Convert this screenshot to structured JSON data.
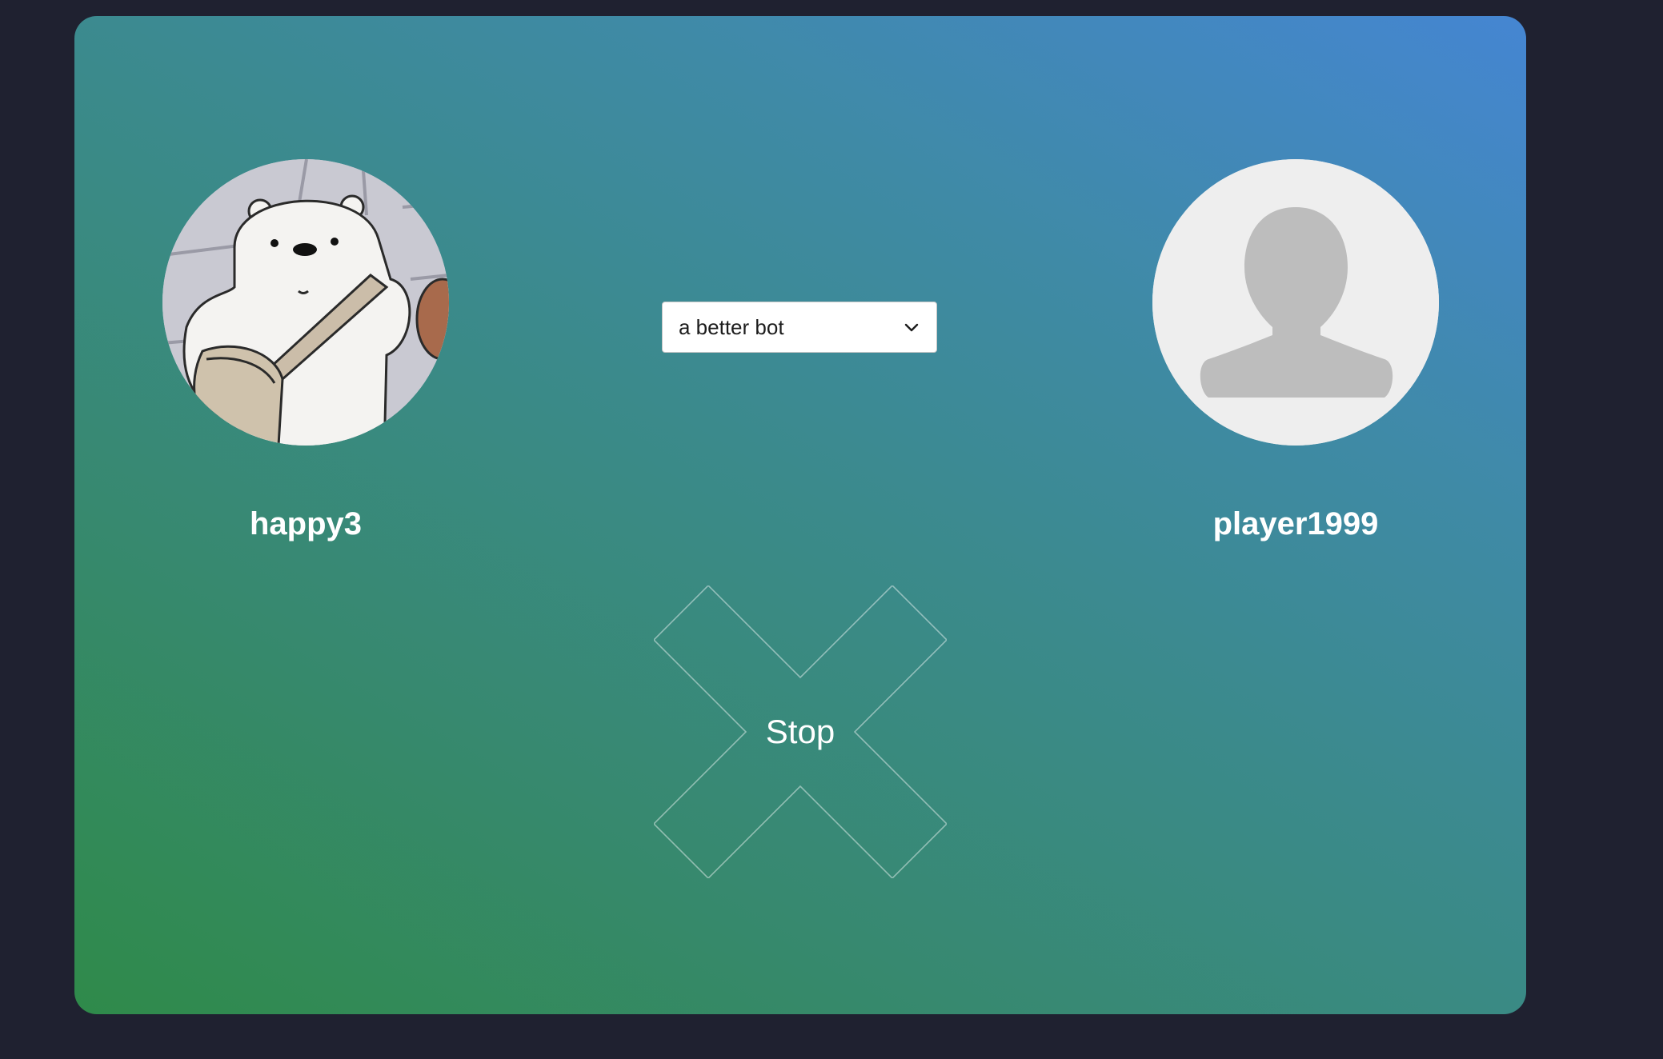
{
  "players": {
    "left": {
      "name": "happy3",
      "avatar": "polar-bear-avatar"
    },
    "right": {
      "name": "player1999",
      "avatar": "default-user-avatar"
    }
  },
  "opponent_select": {
    "selected": "a better bot",
    "icon": "chevron-down-icon"
  },
  "stop_button": {
    "label": "Stop",
    "icon": "x-cross-icon"
  },
  "colors": {
    "page_background": "#1f2130",
    "gradient_start": "#2f8a4a",
    "gradient_end": "#4586d2",
    "text": "#ffffff"
  }
}
